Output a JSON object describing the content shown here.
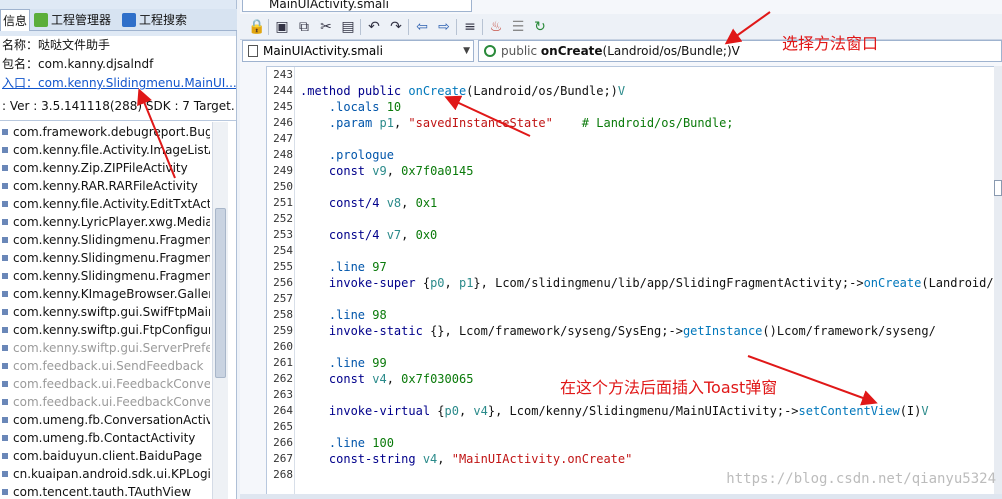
{
  "left_panel": {
    "tabs": [
      {
        "label": "信息",
        "icon": "info-icon"
      },
      {
        "label": "工程管理器",
        "icon": "android-icon"
      },
      {
        "label": "工程搜索",
        "icon": "search-icon"
      }
    ],
    "info": {
      "name": "名称：哒哒文件助手",
      "package": "包名：com.kanny.djsalndf",
      "entry": "入口：com.kenny.Slidingmenu.MainUI...",
      "version": ": Ver : 3.5.141118(288) SDK : 7 Target..."
    },
    "items": [
      {
        "label": "com.framework.debugreport.BugR",
        "disabled": false
      },
      {
        "label": "com.kenny.file.Activity.ImageListAc",
        "disabled": false
      },
      {
        "label": "com.kenny.Zip.ZIPFileActivity",
        "disabled": false
      },
      {
        "label": "com.kenny.RAR.RARFileActivity",
        "disabled": false
      },
      {
        "label": "com.kenny.file.Activity.EditTxtActivi",
        "disabled": false
      },
      {
        "label": "com.kenny.LyricPlayer.xwg.MediaP",
        "disabled": false
      },
      {
        "label": "com.kenny.Slidingmenu.Fragment.",
        "disabled": false
      },
      {
        "label": "com.kenny.Slidingmenu.Fragment.",
        "disabled": false
      },
      {
        "label": "com.kenny.Slidingmenu.Fragment.",
        "disabled": false
      },
      {
        "label": "com.kenny.KImageBrowser.Gallery",
        "disabled": false
      },
      {
        "label": "com.kenny.swiftp.gui.SwifFtpMain",
        "disabled": false
      },
      {
        "label": "com.kenny.swiftp.gui.FtpConfigure",
        "disabled": false
      },
      {
        "label": "com.kenny.swiftp.gui.ServerPrefere",
        "disabled": true
      },
      {
        "label": "com.feedback.ui.SendFeedback",
        "disabled": true
      },
      {
        "label": "com.feedback.ui.FeedbackConvers",
        "disabled": true
      },
      {
        "label": "com.feedback.ui.FeedbackConvers",
        "disabled": true
      },
      {
        "label": "com.umeng.fb.ConversationActivity",
        "disabled": false
      },
      {
        "label": "com.umeng.fb.ContactActivity",
        "disabled": false
      },
      {
        "label": "com.baiduyun.client.BaiduPage",
        "disabled": false
      },
      {
        "label": "cn.kuaipan.android.sdk.ui.KPLogin",
        "disabled": false
      },
      {
        "label": "com.tencent.tauth.TAuthView",
        "disabled": false
      }
    ]
  },
  "editor": {
    "file_tab": "MainUIActivity.smali",
    "file_combo": "MainUIActivity.smali",
    "method_combo": {
      "prefix": "public ",
      "name": "onCreate",
      "args": "(Landroid/os/Bundle;)V"
    },
    "toolbar_icons": [
      "lock-icon",
      "save-icon",
      "copy-icon",
      "cut-icon",
      "paste-icon",
      "undo-icon",
      "redo-icon",
      "back-icon",
      "forward-icon",
      "format-icon",
      "java-icon",
      "list-icon",
      "build-icon"
    ],
    "lines": [
      {
        "n": "243",
        "t": []
      },
      {
        "n": "244",
        "t": [
          [
            "k",
            ".method "
          ],
          [
            "k",
            "public "
          ],
          [
            "m",
            "onCreate"
          ],
          [
            "n",
            "(Landroid/os/Bundle;)"
          ],
          [
            "v",
            "V"
          ]
        ]
      },
      {
        "n": "245",
        "t": [
          [
            "n",
            "    "
          ],
          [
            "d",
            ".locals "
          ],
          [
            "c",
            "10"
          ]
        ]
      },
      {
        "n": "246",
        "t": [
          [
            "n",
            "    "
          ],
          [
            "d",
            ".param "
          ],
          [
            "v",
            "p1"
          ],
          [
            "n",
            ", "
          ],
          [
            "s",
            "\"savedInstanceState\""
          ],
          [
            "n",
            "    "
          ],
          [
            "c",
            "# Landroid/os/Bundle;"
          ]
        ]
      },
      {
        "n": "247",
        "t": []
      },
      {
        "n": "248",
        "t": [
          [
            "n",
            "    "
          ],
          [
            "d",
            ".prologue"
          ]
        ]
      },
      {
        "n": "249",
        "t": [
          [
            "n",
            "    "
          ],
          [
            "k",
            "const "
          ],
          [
            "v",
            "v9"
          ],
          [
            "n",
            ", "
          ],
          [
            "c",
            "0x7f0a0145"
          ]
        ]
      },
      {
        "n": "250",
        "t": []
      },
      {
        "n": "251",
        "t": [
          [
            "n",
            "    "
          ],
          [
            "k",
            "const/4 "
          ],
          [
            "v",
            "v8"
          ],
          [
            "n",
            ", "
          ],
          [
            "c",
            "0x1"
          ]
        ]
      },
      {
        "n": "252",
        "t": []
      },
      {
        "n": "253",
        "t": [
          [
            "n",
            "    "
          ],
          [
            "k",
            "const/4 "
          ],
          [
            "v",
            "v7"
          ],
          [
            "n",
            ", "
          ],
          [
            "c",
            "0x0"
          ]
        ]
      },
      {
        "n": "254",
        "t": []
      },
      {
        "n": "255",
        "t": [
          [
            "n",
            "    "
          ],
          [
            "d",
            ".line "
          ],
          [
            "c",
            "97"
          ]
        ]
      },
      {
        "n": "256",
        "t": [
          [
            "n",
            "    "
          ],
          [
            "k",
            "invoke-super "
          ],
          [
            "n",
            "{"
          ],
          [
            "v",
            "p0"
          ],
          [
            "n",
            ", "
          ],
          [
            "v",
            "p1"
          ],
          [
            "n",
            "}, Lcom/slidingmenu/lib/app/SlidingFragmentActivity;->"
          ],
          [
            "m",
            "onCreate"
          ],
          [
            "n",
            "(Landroid/"
          ]
        ]
      },
      {
        "n": "257",
        "t": []
      },
      {
        "n": "258",
        "t": [
          [
            "n",
            "    "
          ],
          [
            "d",
            ".line "
          ],
          [
            "c",
            "98"
          ]
        ]
      },
      {
        "n": "259",
        "t": [
          [
            "n",
            "    "
          ],
          [
            "k",
            "invoke-static "
          ],
          [
            "n",
            "{}, Lcom/framework/syseng/SysEng;->"
          ],
          [
            "m",
            "getInstance"
          ],
          [
            "n",
            "()Lcom/framework/syseng/"
          ]
        ]
      },
      {
        "n": "260",
        "t": []
      },
      {
        "n": "261",
        "t": [
          [
            "n",
            "    "
          ],
          [
            "d",
            ".line "
          ],
          [
            "c",
            "99"
          ]
        ]
      },
      {
        "n": "262",
        "t": [
          [
            "n",
            "    "
          ],
          [
            "k",
            "const "
          ],
          [
            "v",
            "v4"
          ],
          [
            "n",
            ", "
          ],
          [
            "c",
            "0x7f030065"
          ]
        ]
      },
      {
        "n": "263",
        "t": []
      },
      {
        "n": "264",
        "t": [
          [
            "n",
            "    "
          ],
          [
            "k",
            "invoke-virtual "
          ],
          [
            "n",
            "{"
          ],
          [
            "v",
            "p0"
          ],
          [
            "n",
            ", "
          ],
          [
            "v",
            "v4"
          ],
          [
            "n",
            "}, Lcom/kenny/Slidingmenu/MainUIActivity;->"
          ],
          [
            "m",
            "setContentView"
          ],
          [
            "n",
            "(I)"
          ],
          [
            "v",
            "V"
          ]
        ]
      },
      {
        "n": "265",
        "t": []
      },
      {
        "n": "266",
        "t": [
          [
            "n",
            "    "
          ],
          [
            "d",
            ".line "
          ],
          [
            "c",
            "100"
          ]
        ]
      },
      {
        "n": "267",
        "t": [
          [
            "n",
            "    "
          ],
          [
            "k",
            "const-string "
          ],
          [
            "v",
            "v4"
          ],
          [
            "n",
            ", "
          ],
          [
            "s",
            "\"MainUIActivity.onCreate\""
          ]
        ]
      },
      {
        "n": "268",
        "t": []
      }
    ]
  },
  "annotations": {
    "select_method": "选择方法窗口",
    "insert_toast": "在这个方法后面插入Toast弹窗"
  },
  "watermark": "https://blog.csdn.net/qianyu5324",
  "colors": {
    "annotation": "#e01818",
    "keyword": "#00008b",
    "string": "#c01414",
    "number": "#0a7a0a",
    "method": "#0077bb"
  }
}
